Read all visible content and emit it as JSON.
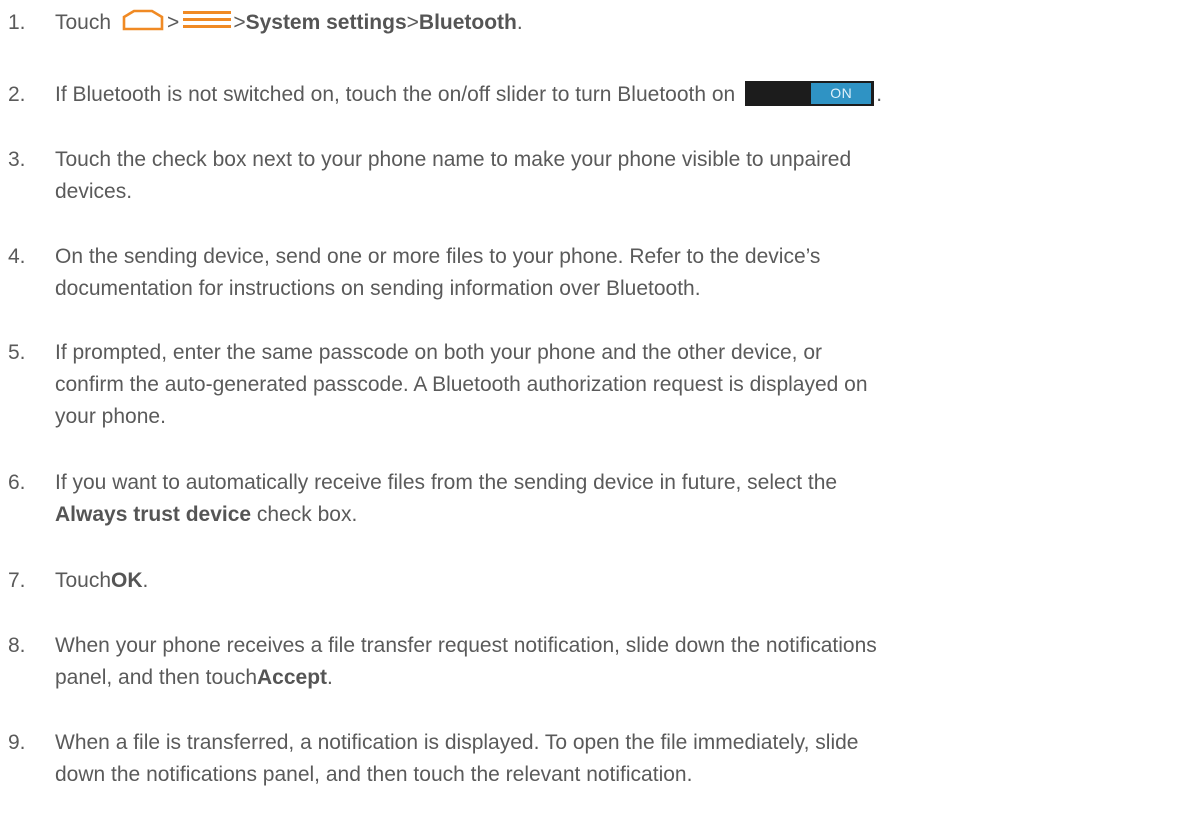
{
  "steps": [
    {
      "num": "1.",
      "pre": "Touch",
      "sep1": ">",
      "sep2": ">",
      "bold1": "System settings",
      "sep3": ">",
      "bold2": "Bluetooth",
      "post": ".",
      "icons": [
        "home-outline-icon",
        "menu-lines-icon"
      ]
    },
    {
      "num": "2.",
      "text": "If Bluetooth is not switched on, touch the on/off slider to turn Bluetooth on",
      "toggle_label": "ON",
      "post": "."
    },
    {
      "num": "3.",
      "line1": "Touch the check box next to your phone name to make your phone visible to unpaired",
      "line2": "devices."
    },
    {
      "num": "4.",
      "line1": "On the sending device, send one or more files to your phone. Refer to the device’s",
      "line2": "documentation for instructions on sending information over Bluetooth."
    },
    {
      "num": "5.",
      "line1": "If prompted, enter the same passcode on both your phone and the other device, or",
      "line2": "confirm the auto-generated passcode. A Bluetooth authorization request is displayed on",
      "line3": "your phone."
    },
    {
      "num": "6.",
      "line1": "If you want to automatically receive files from the sending device in future, select the",
      "bold": "Always trust device",
      "line2_post": " check box."
    },
    {
      "num": "7.",
      "pre": "Touch",
      "bold": "OK",
      "post": "."
    },
    {
      "num": "8.",
      "line1": "When your phone receives a file transfer request notification, slide down the notifications",
      "line2_pre": "panel, and then touch",
      "bold": "Accept",
      "post": "."
    },
    {
      "num": "9.",
      "line1": "When a file is transferred, a notification is displayed. To open the file immediately, slide",
      "line2": "down the notifications panel, and then touch the relevant notification."
    }
  ],
  "colors": {
    "text": "#5a5a5a",
    "icon_orange": "#f08a24",
    "toggle_bg": "#1c1c1c",
    "toggle_on": "#2f93c4"
  }
}
